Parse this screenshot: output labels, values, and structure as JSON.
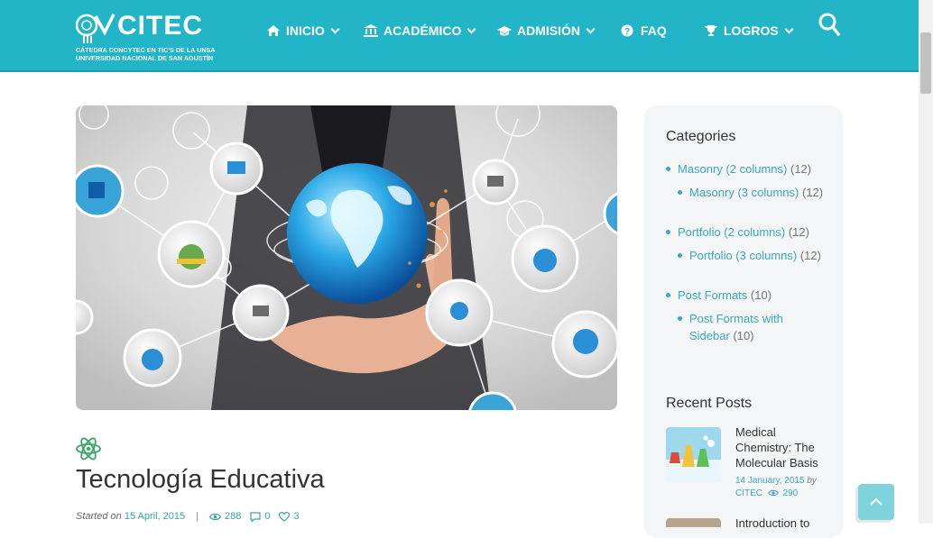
{
  "brand": {
    "name": "CITEC",
    "subtitle_line1": "CÁTEDRA CONCYTEC EN TIC'S DE LA UNSA",
    "subtitle_line2": "UNIVERSIDAD NACIONAL DE SAN AGUSTÍN"
  },
  "nav": [
    {
      "label": "INICIO",
      "icon": "home-icon",
      "has_dropdown": true
    },
    {
      "label": "ACADÉMICO",
      "icon": "bank-icon",
      "has_dropdown": true
    },
    {
      "label": "ADMISIÓN",
      "icon": "graduation-cap-icon",
      "has_dropdown": true
    },
    {
      "label": "FAQ",
      "icon": "question-circle-icon",
      "has_dropdown": false
    },
    {
      "label": "LOGROS",
      "icon": "trophy-icon",
      "has_dropdown": true
    }
  ],
  "post": {
    "title": "Tecnología Educativa",
    "started_label": "Started on",
    "date": "15 April, 2015",
    "separator": "|",
    "views": "288",
    "comments": "0",
    "likes": "3"
  },
  "sidebar": {
    "categories_heading": "Categories",
    "categories": [
      {
        "label": "Masonry (2 columns)",
        "count": "(12)",
        "level": 0
      },
      {
        "label": "Masonry (3 columns)",
        "count": "(12)",
        "level": 1
      },
      {
        "label": "Portfolio (2 columns)",
        "count": "(12)",
        "level": 0
      },
      {
        "label": "Portfolio (3 columns)",
        "count": "(12)",
        "level": 1
      },
      {
        "label": "Post Formats",
        "count": "(10)",
        "level": 0
      },
      {
        "label": "Post Formats with Sidebar",
        "count": "(10)",
        "level": 1
      }
    ],
    "recent_heading": "Recent Posts",
    "recent": [
      {
        "title": "Medical Chemistry: The Molecular Basis",
        "date": "14 January, 2015",
        "by": "by",
        "author": "CITEC",
        "views": "290"
      },
      {
        "title": "Introduction to"
      }
    ]
  },
  "colors": {
    "header": "#22b5c7",
    "accent": "#3ba7c0"
  }
}
